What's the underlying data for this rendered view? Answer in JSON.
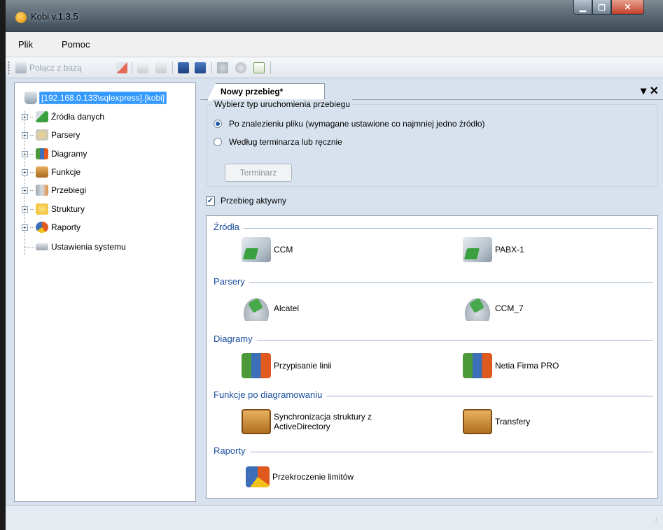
{
  "window": {
    "title": "Kobi v.1.3.5",
    "caption_buttons": {
      "minimize": "▁",
      "maximize": "▢",
      "close": "✕"
    }
  },
  "menu": [
    "Plik",
    "Pomoc"
  ],
  "toolbar": {
    "connect_label": "Połącz z bazą",
    "icons": [
      "database-connect-icon",
      "database-disconnect-icon",
      "new-icon",
      "check-icon",
      "save-icon",
      "save-all-icon",
      "puzzle-icon",
      "gears-icon",
      "refresh-icon"
    ]
  },
  "tree": {
    "root": "[192.168.0.133\\sqlexpress].[kobi]",
    "nodes": [
      {
        "label": "Źródła danych",
        "expandable": true
      },
      {
        "label": "Parsery",
        "expandable": true
      },
      {
        "label": "Diagramy",
        "expandable": true
      },
      {
        "label": "Funkcje",
        "expandable": true
      },
      {
        "label": "Przebiegi",
        "expandable": true
      },
      {
        "label": "Struktury",
        "expandable": true
      },
      {
        "label": "Raporty",
        "expandable": true
      },
      {
        "label": "Ustawienia systemu",
        "expandable": false
      }
    ],
    "expander_glyph": "+"
  },
  "tab": {
    "label": "Nowy przebieg*",
    "tools": "▾ ✕"
  },
  "run_type": {
    "legend": "Wybierz typ uruchomienia przebiegu",
    "options": [
      {
        "label": "Po znalezieniu pliku (wymagane ustawione co najmniej jedno źródło)",
        "selected": true
      },
      {
        "label": "Według terminarza lub ręcznie",
        "selected": false
      }
    ],
    "schedule_button": "Terminarz"
  },
  "active": {
    "label": "Przebieg aktywny",
    "checked": true,
    "check_glyph": "✓"
  },
  "sections": [
    {
      "title": "Źródła",
      "items": [
        "CCM",
        "PABX-1"
      ],
      "icon": "source"
    },
    {
      "title": "Parsery",
      "items": [
        "Alcatel",
        "CCM_7"
      ],
      "icon": "parser"
    },
    {
      "title": "Diagramy",
      "items": [
        "Przypisanie linii",
        "Netia Firma PRO"
      ],
      "icon": "diagram"
    },
    {
      "title": "Funkcje po diagramowaniu",
      "items": [
        "Synchronizacja struktury z ActiveDirectory",
        "Transfery"
      ],
      "icon": "function"
    },
    {
      "title": "Raporty",
      "items": [
        "Przekroczenie limitów"
      ],
      "icon": "report"
    }
  ],
  "statusbar": {
    "grip": ".:"
  },
  "colors": {
    "selection": "#3399ff",
    "section_heading": "#1a4fa0",
    "window_bg": "#d8e2ee"
  }
}
